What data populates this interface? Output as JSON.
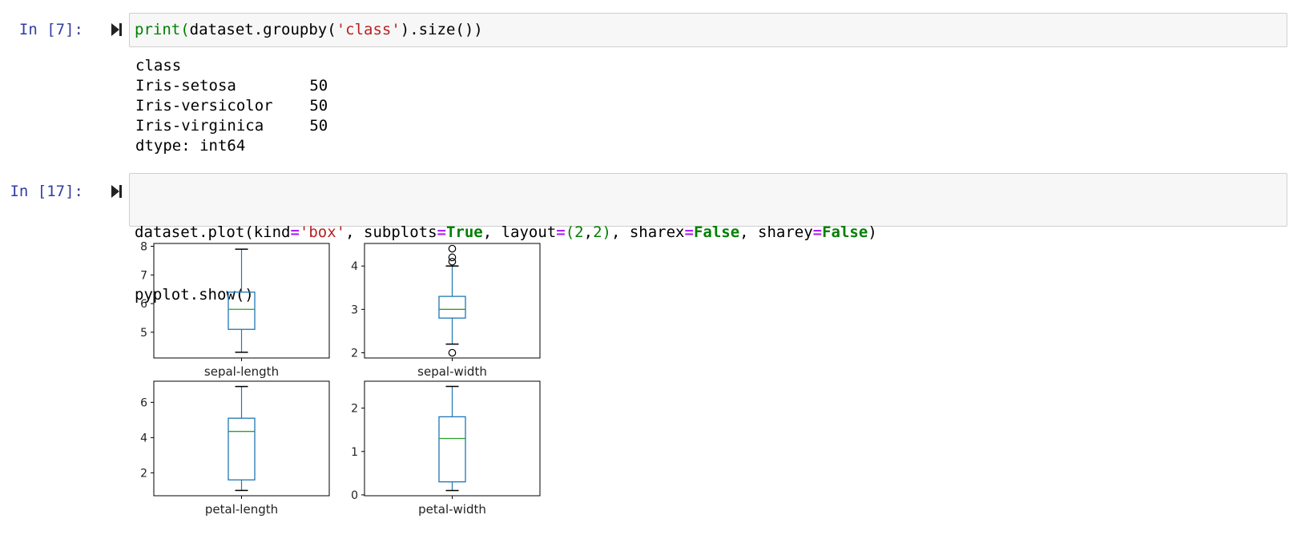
{
  "cells": [
    {
      "prompt": "In [7]:",
      "code_tokens": [
        {
          "t": "print",
          "c": "kw-g"
        },
        {
          "t": "(",
          "c": "kw-g"
        },
        {
          "t": "dataset.groupby(",
          "c": ""
        },
        {
          "t": "'class'",
          "c": "str"
        },
        {
          "t": ").size())",
          "c": ""
        }
      ],
      "output_lines": [
        "class",
        "Iris-setosa        50",
        "Iris-versicolor    50",
        "Iris-virginica     50",
        "dtype: int64"
      ]
    },
    {
      "prompt": "In [17]:",
      "code_line1": [
        {
          "t": "dataset.plot(kind",
          "c": ""
        },
        {
          "t": "=",
          "c": "op"
        },
        {
          "t": "'box'",
          "c": "str"
        },
        {
          "t": ", subplots",
          "c": ""
        },
        {
          "t": "=",
          "c": "op"
        },
        {
          "t": "True",
          "c": "kw-gb"
        },
        {
          "t": ", layout",
          "c": ""
        },
        {
          "t": "=",
          "c": "op"
        },
        {
          "t": "(",
          "c": "num"
        },
        {
          "t": "2",
          "c": "num"
        },
        {
          "t": ",",
          "c": ""
        },
        {
          "t": "2",
          "c": "num"
        },
        {
          "t": ")",
          "c": "num"
        },
        {
          "t": ", sharex",
          "c": ""
        },
        {
          "t": "=",
          "c": "op"
        },
        {
          "t": "False",
          "c": "kw-gb"
        },
        {
          "t": ", sharey",
          "c": ""
        },
        {
          "t": "=",
          "c": "op"
        },
        {
          "t": "False",
          "c": "kw-gb"
        },
        {
          "t": ")",
          "c": ""
        }
      ],
      "code_line2": "pyplot.show()"
    }
  ],
  "colors": {
    "box": "#1f77b4",
    "median": "#2ca02c",
    "prompt": "#303f9f"
  },
  "chart_data": [
    {
      "type": "box",
      "label": "sepal-length",
      "min": 4.3,
      "q1": 5.1,
      "median": 5.8,
      "q3": 6.4,
      "max": 7.9,
      "outliers": [],
      "ylim": [
        4.1,
        8.1
      ],
      "yticks": [
        5,
        6,
        7,
        8
      ]
    },
    {
      "type": "box",
      "label": "sepal-width",
      "min": 2.2,
      "q1": 2.8,
      "median": 3.0,
      "q3": 3.3,
      "max": 4.0,
      "outliers": [
        2.0,
        4.1,
        4.2,
        4.4
      ],
      "ylim": [
        1.88,
        4.52
      ],
      "yticks": [
        2,
        3,
        4
      ]
    },
    {
      "type": "box",
      "label": "petal-length",
      "min": 1.0,
      "q1": 1.6,
      "median": 4.35,
      "q3": 5.1,
      "max": 6.9,
      "outliers": [],
      "ylim": [
        0.7,
        7.2
      ],
      "yticks": [
        2,
        4,
        6
      ]
    },
    {
      "type": "box",
      "label": "petal-width",
      "min": 0.1,
      "q1": 0.3,
      "median": 1.3,
      "q3": 1.8,
      "max": 2.5,
      "outliers": [],
      "ylim": [
        -0.02,
        2.62
      ],
      "yticks": [
        0,
        1,
        2
      ]
    }
  ]
}
